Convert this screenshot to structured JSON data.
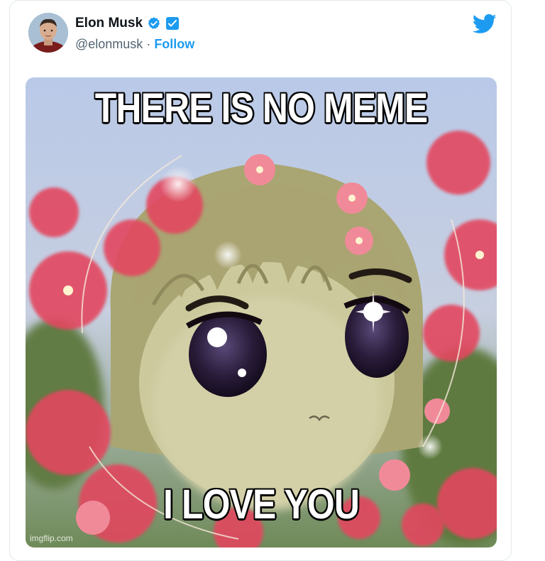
{
  "tweet": {
    "display_name": "Elon Musk",
    "handle": "@elonmusk",
    "separator": " · ",
    "follow_label": "Follow",
    "icons": {
      "verified": "verified-check-icon",
      "badge": "square-badge-icon",
      "brand": "twitter-bird-icon"
    },
    "colors": {
      "accent": "#1d9bf0",
      "name": "#0f1419",
      "handle": "#536471"
    }
  },
  "media": {
    "caption_top": "THERE IS NO MEME",
    "caption_bottom": "I LOVE YOU",
    "watermark": "imgflip.com"
  }
}
